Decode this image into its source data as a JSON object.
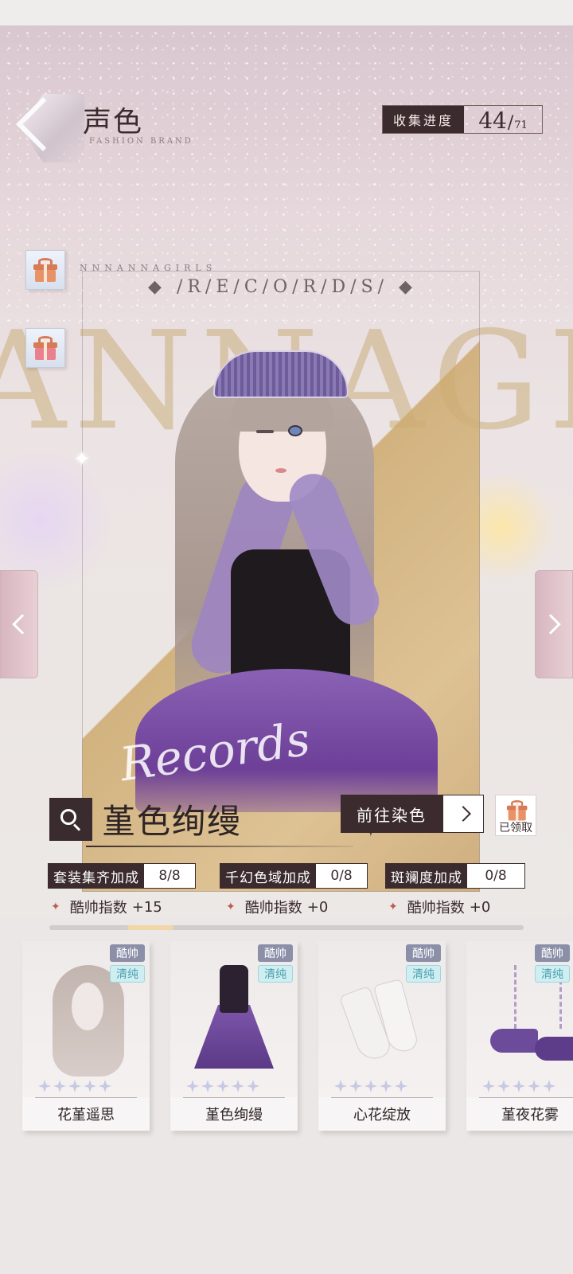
{
  "header": {
    "title": "声色",
    "subtitle": "FASHION BRAND",
    "progress_label": "收集进度",
    "progress_current": "44",
    "progress_total": "71"
  },
  "backdrop": {
    "big_letters": "ANNAGIR",
    "records_mini": "NNNANNAGIRLS",
    "records_title": "◆ /R/E/C/O/R/D/S/ ◆",
    "script_text": "Records"
  },
  "icons": {
    "back": "back-chevron-icon",
    "gift": "gift-icon",
    "gift_palette": "gift-palette-icon",
    "search": "magnifier-icon",
    "arrow_left": "chevron-left-icon",
    "arrow_right": "chevron-right-icon",
    "go": "chevron-right-icon"
  },
  "outfit": {
    "name": "堇色绚缦",
    "dye_button": "前往染色",
    "claimed_label": "已领取"
  },
  "bonuses": [
    {
      "label": "套装集齐加成",
      "value": "8/8",
      "stat": "酷帅指数",
      "stat_value": "+15"
    },
    {
      "label": "千幻色域加成",
      "value": "0/8",
      "stat": "酷帅指数",
      "stat_value": "+0"
    },
    {
      "label": "斑斓度加成",
      "value": "0/8",
      "stat": "酷帅指数",
      "stat_value": "+0"
    }
  ],
  "items": [
    {
      "name": "花堇遥思",
      "tags": [
        "酷帅",
        "清纯"
      ],
      "stars": 5
    },
    {
      "name": "堇色绚缦",
      "tags": [
        "酷帅",
        "清纯"
      ],
      "stars": 5
    },
    {
      "name": "心花绽放",
      "tags": [
        "酷帅",
        "清纯"
      ],
      "stars": 5
    },
    {
      "name": "堇夜花雾",
      "tags": [
        "酷帅",
        "清纯"
      ],
      "stars": 5
    }
  ],
  "colors": {
    "accent_dark": "#3b2b2e",
    "dress_purple": "#7e56ab",
    "tag_pure": "#cfeef2",
    "star": "#c7c9e4"
  }
}
